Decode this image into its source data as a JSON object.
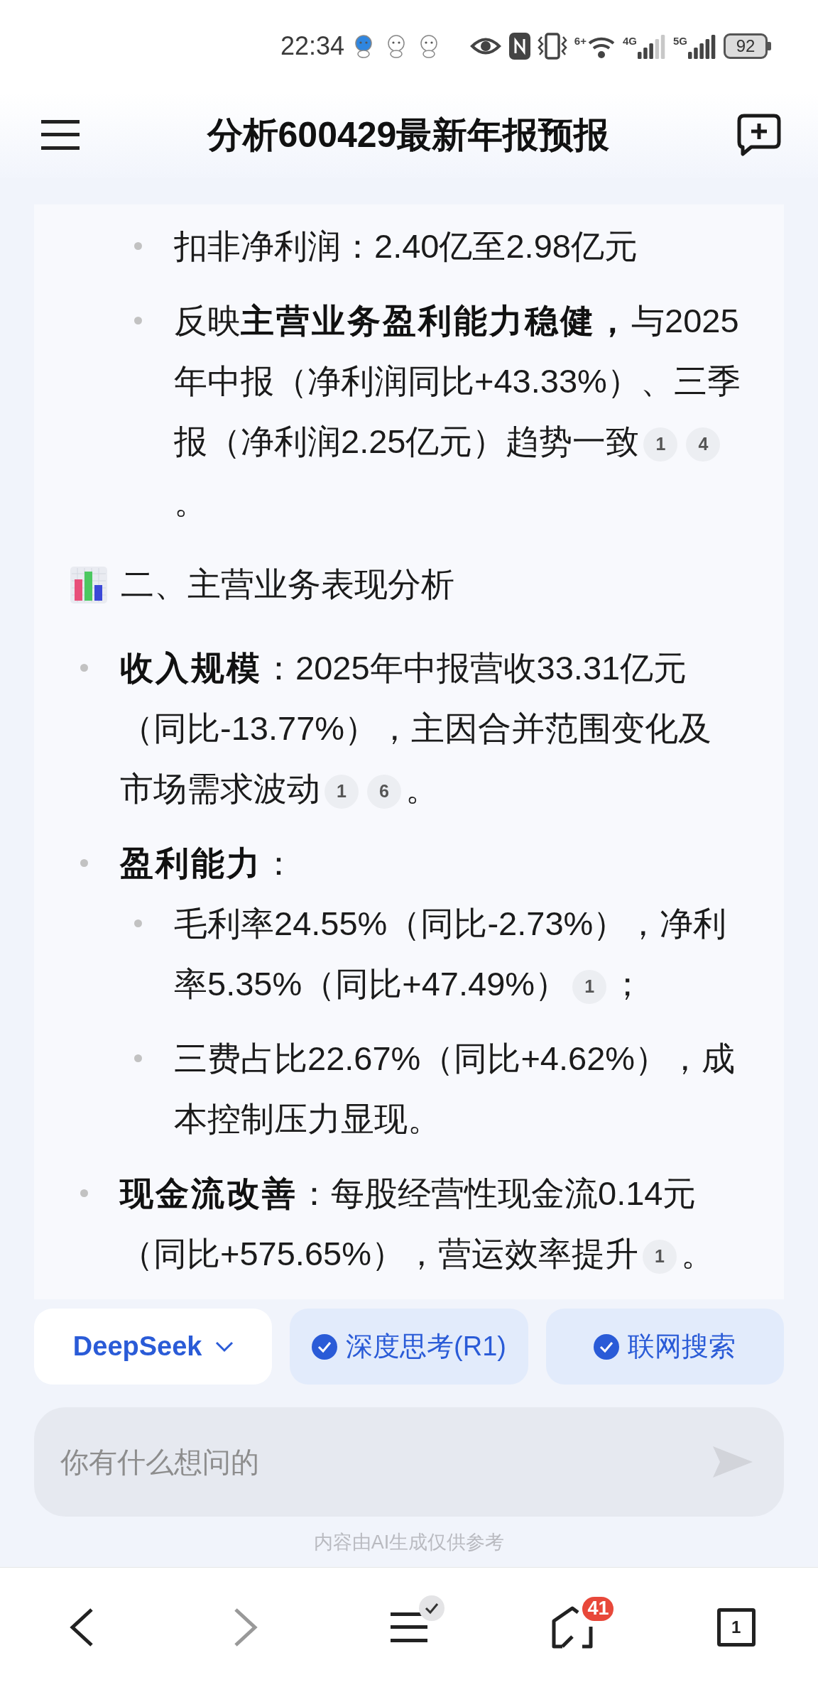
{
  "status_bar": {
    "time": "22:34",
    "wifi_badge": "6+",
    "networks": [
      "4G",
      "5G"
    ],
    "battery": "92"
  },
  "header": {
    "title": "分析600429最新年报预报"
  },
  "content": [
    {
      "kind": "nested_list",
      "items": [
        {
          "text": "扣非净利润：2.40亿至2.98亿元"
        },
        {
          "text": "反映**主营业务盈利能力稳健，**与2025年中报（净利润同比+43.33%）、三季报（净利润2.25亿元）趋势一致",
          "citations": [
            "1",
            "4"
          ],
          "tail": "。"
        }
      ]
    },
    {
      "kind": "heading",
      "text": "二、主营业务表现分析"
    },
    {
      "kind": "list",
      "items": [
        {
          "text": "**收入规模**：2025年中报营收33.31亿元（同比-13.77%），主因合并范围变化及市场需求波动",
          "citations": [
            "1",
            "6"
          ],
          "tail": "。"
        },
        {
          "text": "**盈利能力**：",
          "children": [
            {
              "text": "毛利率24.55%（同比-2.73%），净利率5.35%（同比+47.49%）",
              "citations": [
                "1"
              ],
              "tail": "；"
            },
            {
              "text": "三费占比22.67%（同比+4.62%），成本控制压力显现。"
            }
          ]
        },
        {
          "text": "**现金流改善**：每股经营性现金流0.14元（同比+575.65%），营运效率提升",
          "citations": [
            "1"
          ],
          "tail": "。"
        }
      ]
    }
  ],
  "controls": {
    "model": {
      "label": "DeepSeek"
    },
    "toggles": [
      {
        "label": "深度思考(R1)",
        "on": true
      },
      {
        "label": "联网搜索",
        "on": true
      }
    ]
  },
  "input": {
    "placeholder": "你有什么想问的"
  },
  "disclaimer": "内容由AI生成仅供参考",
  "nav": [
    {
      "kind": "back",
      "disabled": false
    },
    {
      "kind": "forward",
      "disabled": true
    },
    {
      "kind": "menu",
      "disabled": false
    },
    {
      "kind": "home",
      "disabled": false,
      "badge": "41"
    },
    {
      "kind": "tabs",
      "disabled": false,
      "count": "1"
    }
  ]
}
